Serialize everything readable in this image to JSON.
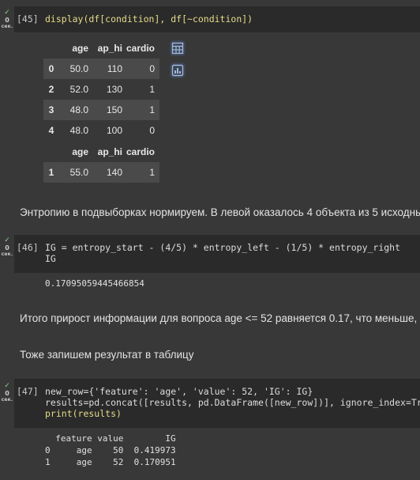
{
  "cells": {
    "c45": {
      "prompt": "[45]",
      "check": "✓",
      "run_num": "0",
      "run_unit": "сек.",
      "code": "display(df[condition], df[~condition])"
    },
    "c46": {
      "prompt": "[46]",
      "check": "✓",
      "run_num": "0",
      "run_unit": "сек.",
      "code_line1": "IG = entropy_start - (4/5) * entropy_left - (1/5) * entropy_right",
      "code_line2": "IG"
    },
    "c47": {
      "prompt": "[47]",
      "check": "✓",
      "run_num": "0",
      "run_unit": "сек.",
      "code_line1": "new_row={'feature': 'age', 'value': 52, 'IG': IG}",
      "code_line2": "results=pd.concat([results, pd.DataFrame([new_row])], ignore_index=True)",
      "code_line3": "print(results)"
    }
  },
  "table1": {
    "headers": [
      "",
      "age",
      "ap_hi",
      "cardio"
    ],
    "rows": [
      [
        "0",
        "50.0",
        "110",
        "0"
      ],
      [
        "2",
        "52.0",
        "130",
        "1"
      ],
      [
        "3",
        "48.0",
        "150",
        "1"
      ],
      [
        "4",
        "48.0",
        "100",
        "0"
      ]
    ]
  },
  "table2": {
    "headers": [
      "",
      "age",
      "ap_hi",
      "cardio"
    ],
    "rows": [
      [
        "1",
        "55.0",
        "140",
        "1"
      ]
    ]
  },
  "side_buttons": {
    "table_icon": "table-icon",
    "chart_icon": "chart-icon"
  },
  "text": {
    "entropy_note": "Энтропию в подвыборках нормируем. В левой оказалось 4 объекта из 5 исходны",
    "ig_value": "0.17095059445466854",
    "ig_summary": "Итого прирост информации для вопроса age <= 52 равняется 0.17, что меньше, ч",
    "record_note": "Тоже запишем результат в таблицу"
  },
  "results_output": {
    "header": "  feature value        IG",
    "row0": "0     age    50  0.419973",
    "row1": "1     age    52  0.170951"
  }
}
